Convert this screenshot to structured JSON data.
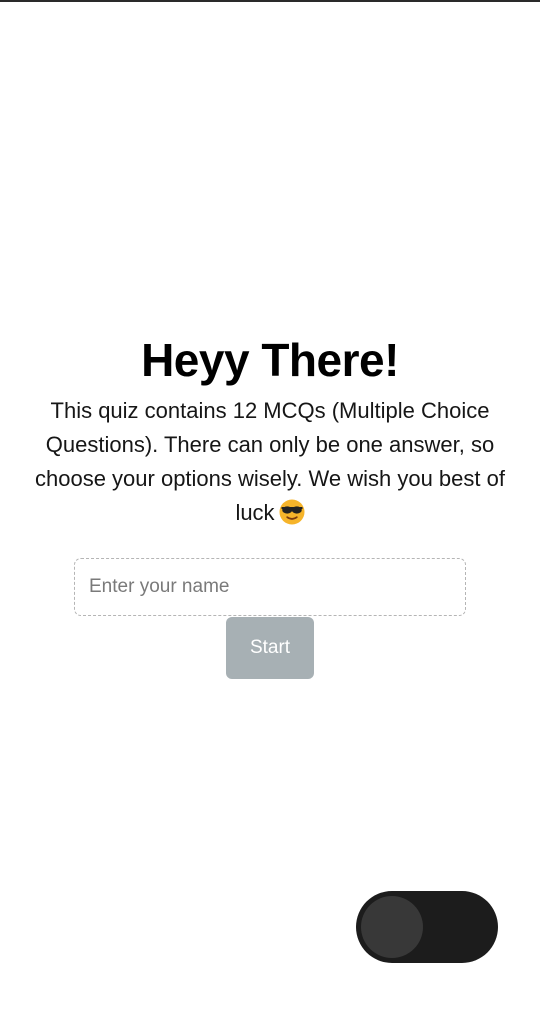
{
  "intro": {
    "title": "Heyy There!",
    "description": "This quiz contains 12 MCQs (Multiple Choice Questions). There can only be one answer, so choose your options wisely. We wish you best of luck",
    "emoji_icon": "sunglasses-face-icon"
  },
  "form": {
    "name_input": {
      "placeholder": "Enter your name",
      "value": ""
    },
    "start_label": "Start"
  },
  "theme_toggle": {
    "state": "off",
    "track_color": "#1c1c1c",
    "knob_color": "#383838"
  },
  "colors": {
    "start_button": "#a7b0b4",
    "top_bar": "#2a2a2a"
  }
}
